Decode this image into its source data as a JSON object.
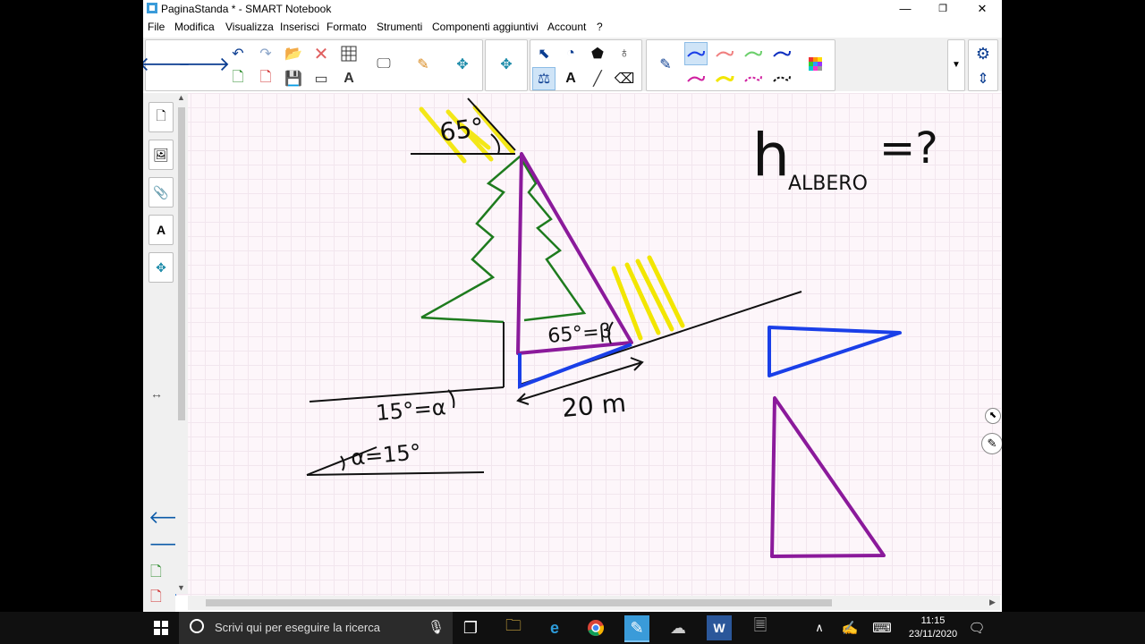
{
  "window": {
    "title": "PaginaStanda * - SMART Notebook",
    "minimize": "—",
    "restore": "❐",
    "close": "✕"
  },
  "menu": [
    "File",
    "Modifica",
    "Visualizza",
    "Inserisci",
    "Formato",
    "Strumenti",
    "Componenti aggiuntivi",
    "Account",
    "?"
  ],
  "board": {
    "label_65_top": "65°",
    "label_h": "h",
    "label_subscript": "ALBERO",
    "label_eq": "=?",
    "label_beta": "65°=β",
    "label_alpha1": "15°=α",
    "label_alpha2": "α=15°",
    "label_length": "20 m"
  },
  "taskbar": {
    "search_placeholder": "Scrivi qui per eseguire la ricerca",
    "time": "11:15",
    "date": "23/11/2020"
  },
  "colors": {
    "purple": "#8b1a9b",
    "blue": "#1a3fe8",
    "green": "#1e7b1e",
    "yellow": "#f2e600",
    "black": "#111111",
    "accent": "#4a90d9"
  }
}
